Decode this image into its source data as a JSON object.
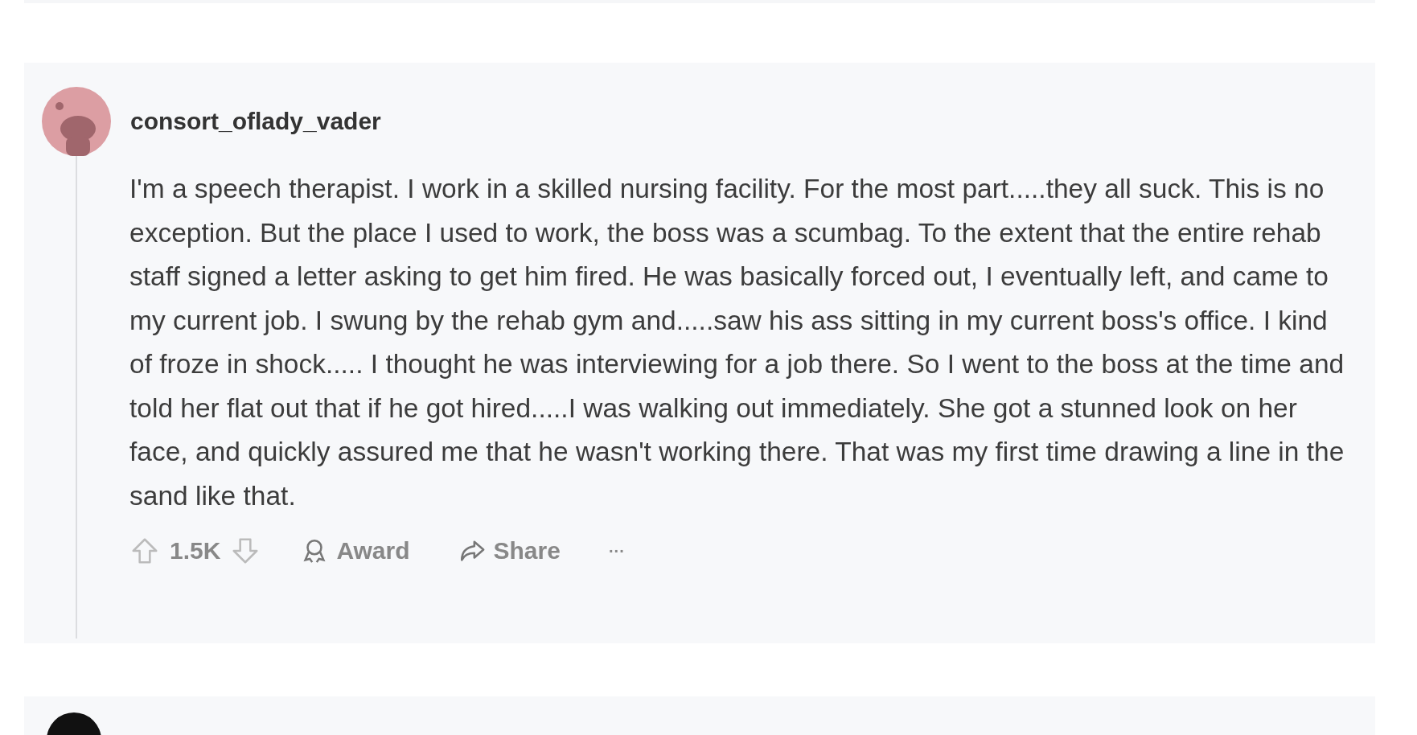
{
  "comment": {
    "username": "consort_oflady_vader",
    "body": "I'm a speech therapist. I work in a skilled nursing facility. For the most part.....they all suck. This is no exception. But the place I used to work, the boss was a scumbag. To the extent that the entire rehab staff signed a letter asking to get him fired. He was basically forced out, I eventually left, and came to my current job. I swung by the rehab gym and.....saw his ass sitting in my current boss's office. I kind of froze in shock..... I thought he was interviewing for a job there. So I went to the boss at the time and told her flat out that if he got hired.....I was walking out immediately. She got a stunned look on her face, and quickly assured me that he wasn't working there. That was my first time drawing a line in the sand like that.",
    "score": "1.5K",
    "actions": [
      {
        "kind": "award",
        "label": "Award"
      },
      {
        "kind": "share",
        "label": "Share"
      },
      {
        "kind": "more",
        "label": "···"
      }
    ]
  }
}
